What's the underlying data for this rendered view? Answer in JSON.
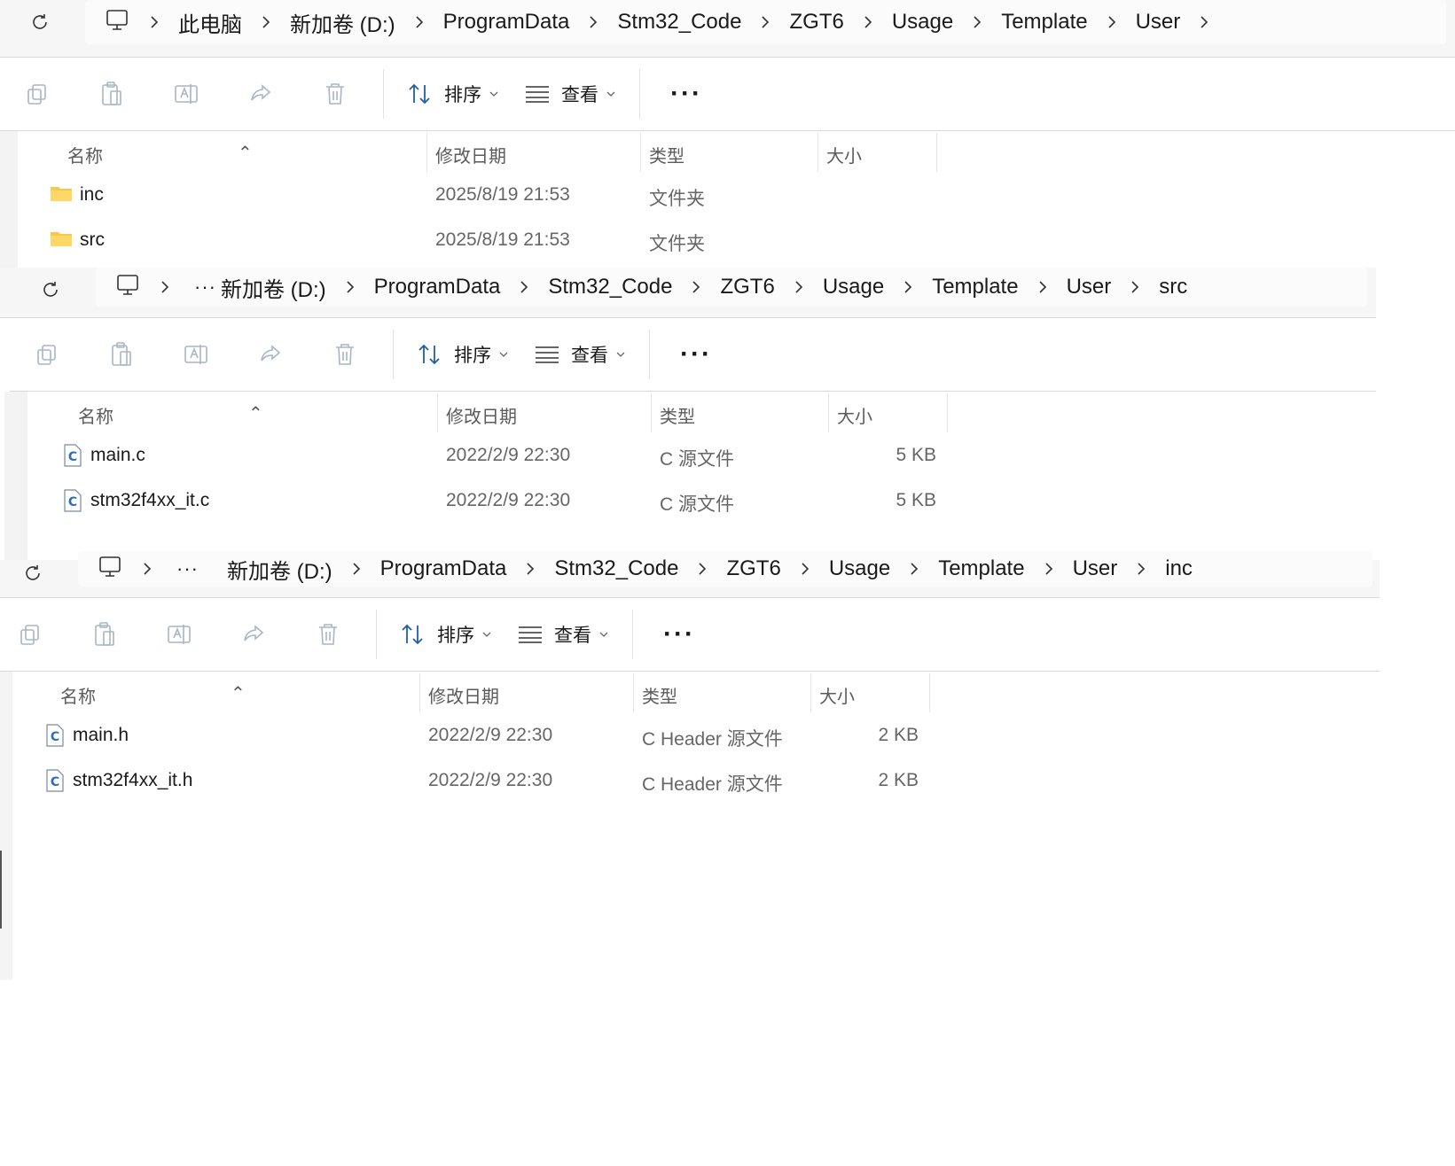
{
  "columns": {
    "name": "名称",
    "modified": "修改日期",
    "type": "类型",
    "size": "大小"
  },
  "toolbar": {
    "sort": "排序",
    "view": "查看",
    "more": "···"
  },
  "colors": {
    "folder": "#F7C948",
    "c_file": "#2F6DB5",
    "accent": "#0067C0"
  },
  "windows": [
    {
      "breadcrumb": [
        "此电脑",
        "新加卷 (D:)",
        "ProgramData",
        "Stm32_Code",
        "ZGT6",
        "Usage",
        "Template",
        "User"
      ],
      "collapsed": false,
      "files": [
        {
          "name": "inc",
          "modified": "2025/8/19 21:53",
          "type": "文件夹",
          "size": "",
          "icon": "folder-icon"
        },
        {
          "name": "src",
          "modified": "2025/8/19 21:53",
          "type": "文件夹",
          "size": "",
          "icon": "folder-icon"
        }
      ]
    },
    {
      "breadcrumb": [
        "新加卷 (D:)",
        "ProgramData",
        "Stm32_Code",
        "ZGT6",
        "Usage",
        "Template",
        "User",
        "src"
      ],
      "collapsed": true,
      "files": [
        {
          "name": "main.c",
          "modified": "2022/2/9 22:30",
          "type": "C 源文件",
          "size": "5 KB",
          "icon": "c-file-icon"
        },
        {
          "name": "stm32f4xx_it.c",
          "modified": "2022/2/9 22:30",
          "type": "C 源文件",
          "size": "5 KB",
          "icon": "c-file-icon"
        }
      ]
    },
    {
      "breadcrumb": [
        "新加卷 (D:)",
        "ProgramData",
        "Stm32_Code",
        "ZGT6",
        "Usage",
        "Template",
        "User",
        "inc"
      ],
      "collapsed": true,
      "files": [
        {
          "name": "main.h",
          "modified": "2022/2/9 22:30",
          "type": "C Header 源文件",
          "size": "2 KB",
          "icon": "c-header-icon"
        },
        {
          "name": "stm32f4xx_it.h",
          "modified": "2022/2/9 22:30",
          "type": "C Header 源文件",
          "size": "2 KB",
          "icon": "c-header-icon"
        }
      ]
    }
  ]
}
